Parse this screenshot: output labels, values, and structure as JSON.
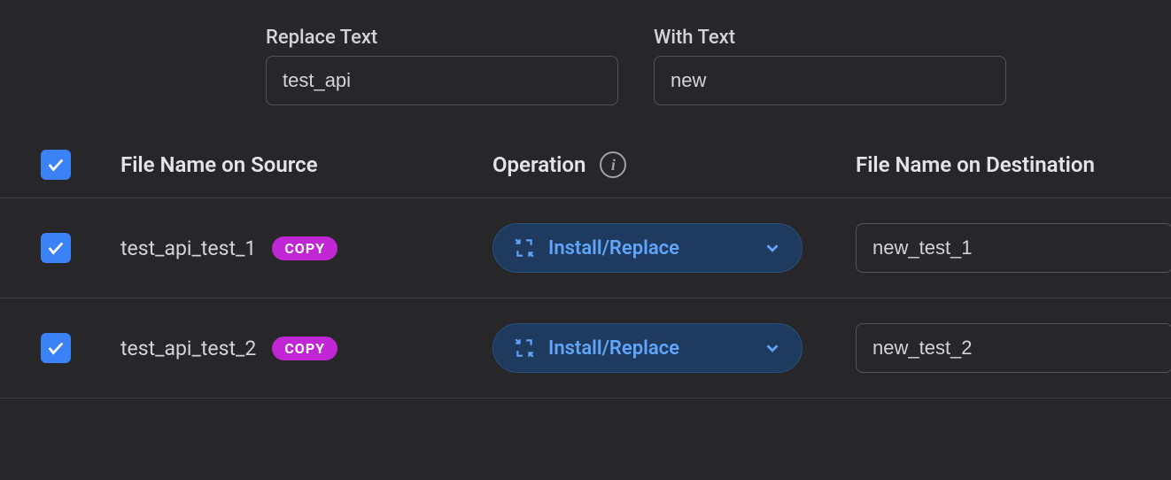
{
  "replace": {
    "label": "Replace Text",
    "value": "test_api"
  },
  "with": {
    "label": "With Text",
    "value": "new"
  },
  "columns": {
    "source": "File Name on Source",
    "operation": "Operation",
    "destination": "File Name on Destination"
  },
  "badge_copy": "COPY",
  "operation_label": "Install/Replace",
  "rows": [
    {
      "source": "test_api_test_1",
      "destination": "new_test_1"
    },
    {
      "source": "test_api_test_2",
      "destination": "new_test_2"
    }
  ]
}
